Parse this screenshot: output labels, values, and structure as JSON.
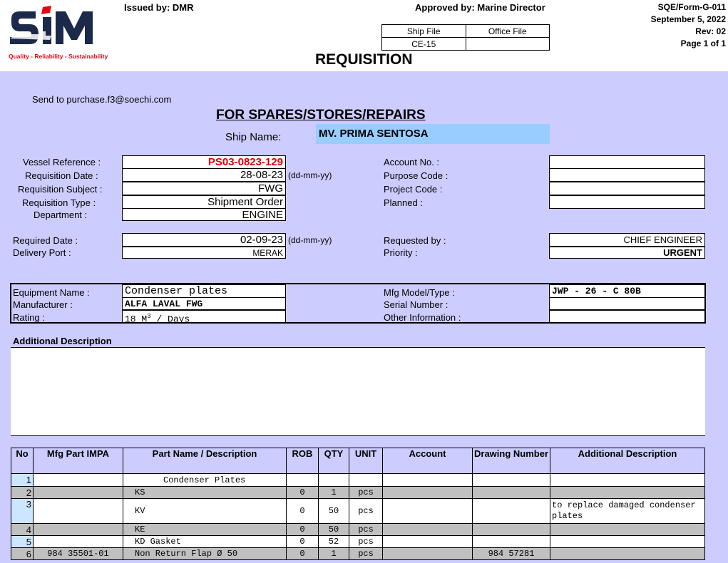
{
  "header": {
    "logo_text": "SiM",
    "logo_tagline": "Quality - Reliability - Sustainability",
    "issued_by": "Issued by: DMR",
    "approved_by": "Approved by: Marine Director",
    "form_no": "SQE/Form-G-011",
    "date": "September 5, 2022",
    "rev": "Rev: 02",
    "page": "Page 1 of 1",
    "ship_file_label": "Ship File",
    "office_file_label": "Office File",
    "ship_file_value": "CE-15",
    "office_file_value": "",
    "doc_title": "REQUISITION"
  },
  "form": {
    "send_to": "Send to purchase.f3@soechi.com",
    "subtitle": "FOR SPARES/STORES/REPAIRS",
    "ship_name_label": "Ship Name:",
    "ship_name": "MV. PRIMA SENTOSA",
    "vessel_reference_label": "Vessel Reference :",
    "vessel_reference": "PS03-0823-129",
    "requisition_date_label": "Requisition Date :",
    "requisition_date": "28-08-23",
    "date_format_1": "(dd-mm-yy)",
    "requisition_subject_label": "Requisition Subject :",
    "requisition_subject": "FWG",
    "requisition_type_label": "Requisition Type :",
    "requisition_type": "Shipment Order",
    "department_label": "Department :",
    "department": "ENGINE",
    "account_no_label": "Account No. :",
    "purpose_code_label": "Purpose Code :",
    "project_code_label": "Project Code :",
    "planned_label": "Planned :",
    "required_date_label": "Required Date :",
    "required_date": "02-09-23",
    "date_format_2": "(dd-mm-yy)",
    "delivery_port_label": "Delivery Port :",
    "delivery_port": "MERAK",
    "requested_by_label": "Requested by :",
    "requested_by": "CHIEF ENGINEER",
    "priority_label": "Priority :",
    "priority": "URGENT",
    "equipment_name_label": "Equipment Name :",
    "equipment_name": "Condenser plates",
    "manufacturer_label": "Manufacturer :",
    "manufacturer": "ALFA LAVAL FWG",
    "rating_label": "Rating :",
    "rating_value": "18 M",
    "rating_sup": "3",
    "rating_unit": " / Days",
    "mfg_model_label": "Mfg Model/Type :",
    "mfg_model": "JWP - 26 - C 80B",
    "serial_number_label": "Serial Number :",
    "other_info_label": "Other Information :",
    "additional_description_label": "Additional Description"
  },
  "items_table": {
    "columns": [
      "No",
      "Mfg Part IMPA",
      "Part Name / Description",
      "ROB",
      "QTY",
      "UNIT",
      "Account",
      "Drawing Number",
      "Additional Description"
    ],
    "rows": [
      {
        "no": "1",
        "part": "",
        "name": "Condenser Plates",
        "rob": "",
        "qty": "",
        "unit": "",
        "account": "",
        "drawing": "",
        "desc": ""
      },
      {
        "no": "2",
        "part": "",
        "name": "KS",
        "rob": "0",
        "qty": "1",
        "unit": "pcs",
        "account": "",
        "drawing": "",
        "desc": ""
      },
      {
        "no": "3",
        "part": "",
        "name": "KV",
        "rob": "0",
        "qty": "50",
        "unit": "pcs",
        "account": "",
        "drawing": "",
        "desc": "to replace damaged condenser plates"
      },
      {
        "no": "4",
        "part": "",
        "name": "KE",
        "rob": "0",
        "qty": "50",
        "unit": "pcs",
        "account": "",
        "drawing": "",
        "desc": ""
      },
      {
        "no": "5",
        "part": "",
        "name": "KD Gasket",
        "rob": "0",
        "qty": "52",
        "unit": "pcs",
        "account": "",
        "drawing": "",
        "desc": ""
      },
      {
        "no": "6",
        "part": "984 35501-01",
        "name": "Non Return Flap Ø 50",
        "rob": "0",
        "qty": "1",
        "unit": "pcs",
        "account": "",
        "drawing": "984 57281",
        "desc": ""
      }
    ]
  },
  "colors": {
    "form_bg": "#ccccff",
    "ship_name_bg": "#99ccff",
    "vessel_ref_color": "#e00000",
    "logo_red": "#e30613",
    "logo_navy": "#1b2a4a",
    "row_alt": "#c0c0c0",
    "row_no_bg": "#cce6ff"
  }
}
